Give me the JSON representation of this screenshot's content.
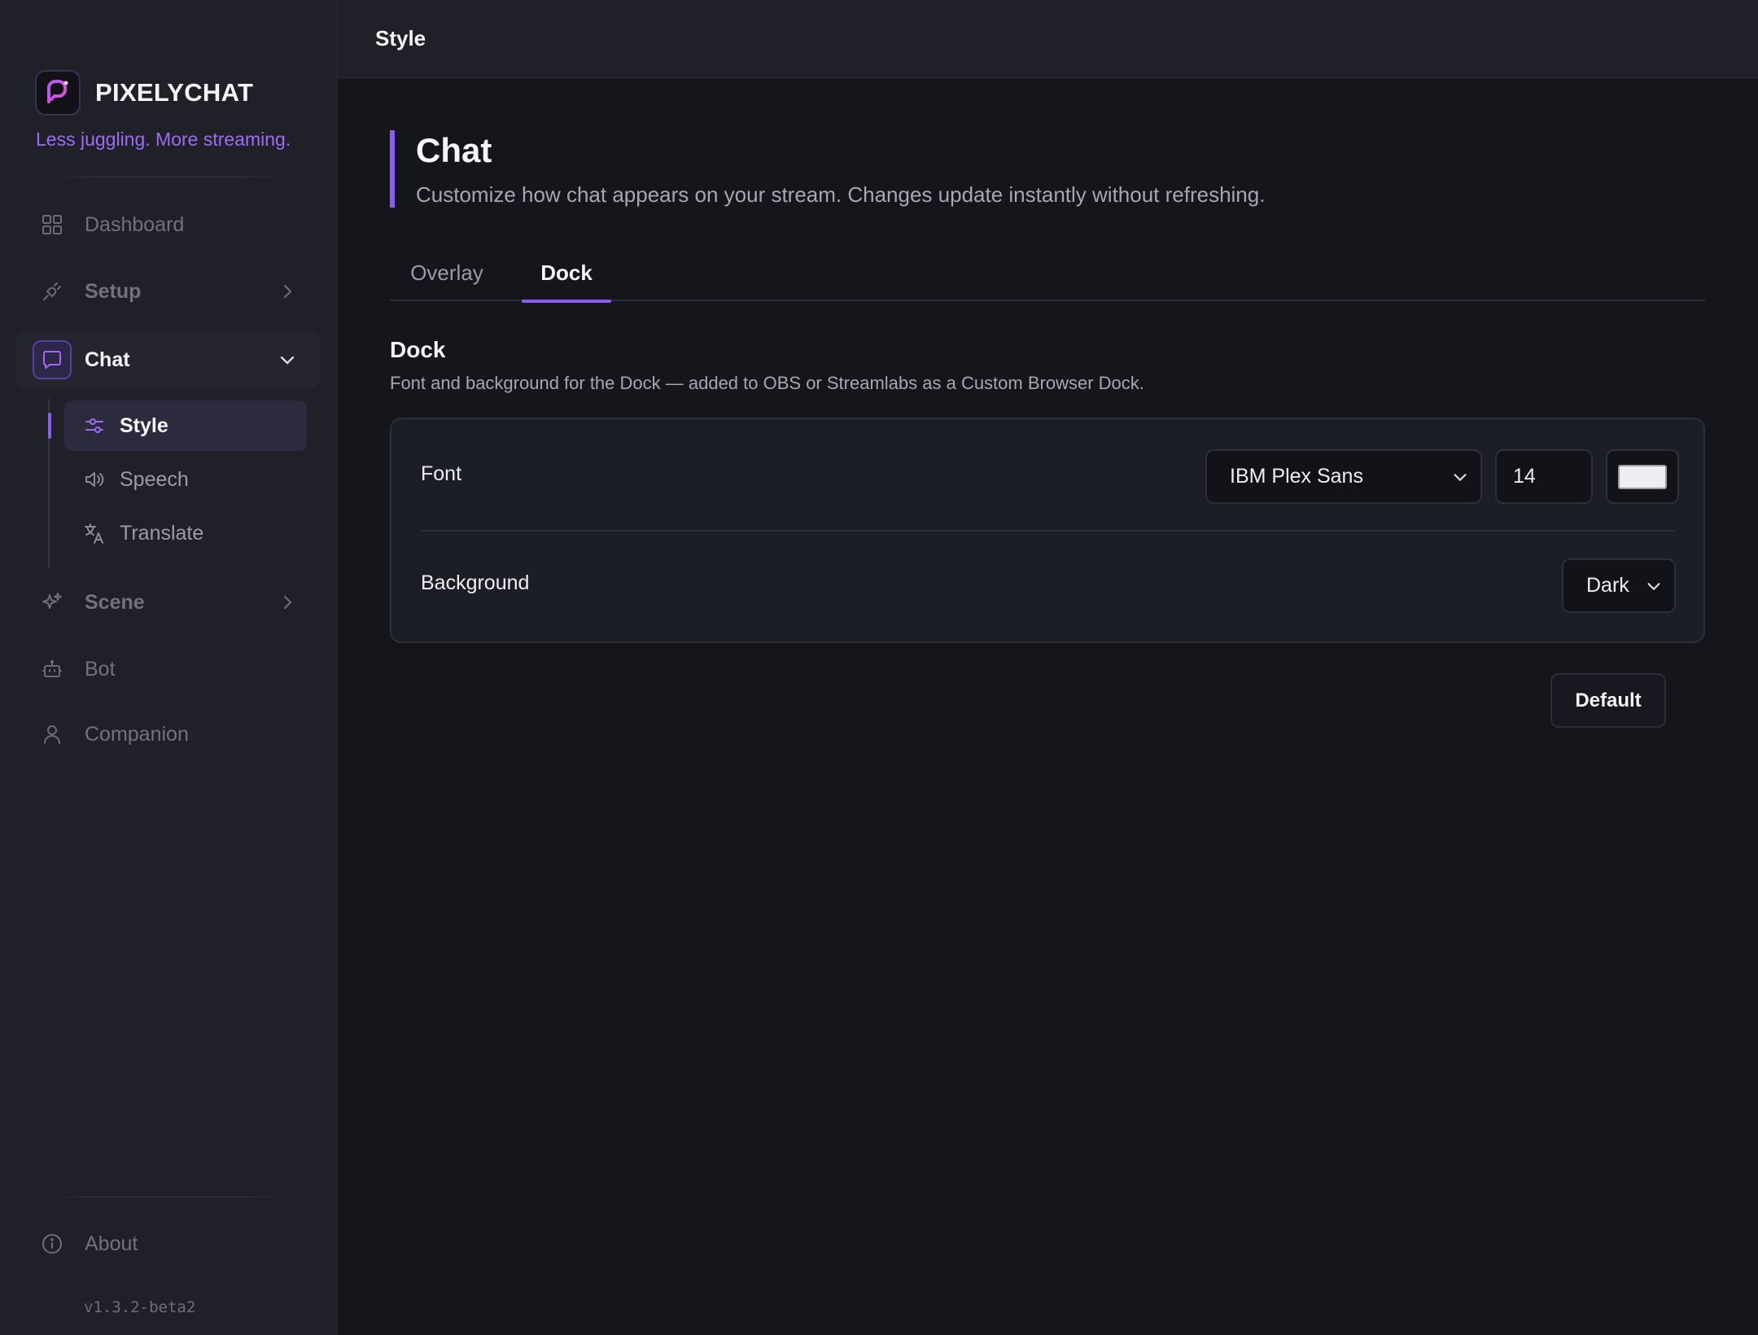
{
  "brand": {
    "name": "PIXELYCHAT",
    "tagline": "Less juggling. More streaming."
  },
  "nav": {
    "dashboard": "Dashboard",
    "setup": "Setup",
    "chat": "Chat",
    "chat_sub": {
      "style": "Style",
      "speech": "Speech",
      "translate": "Translate"
    },
    "scene": "Scene",
    "bot": "Bot",
    "companion": "Companion",
    "about": "About"
  },
  "version": "v1.3.2-beta2",
  "topbar": {
    "title": "Style"
  },
  "page": {
    "title": "Chat",
    "subtitle": "Customize how chat appears on your stream. Changes update instantly without refreshing."
  },
  "tabs": {
    "overlay": "Overlay",
    "dock": "Dock",
    "active": "Dock"
  },
  "section": {
    "title": "Dock",
    "description": "Font and background for the Dock — added to OBS or Streamlabs as a Custom Browser Dock."
  },
  "settings": {
    "font_label": "Font",
    "font_family_value": "IBM Plex Sans",
    "font_size_value": "14",
    "font_color": "#ededf2",
    "background_label": "Background",
    "background_value": "Dark"
  },
  "buttons": {
    "default": "Default"
  },
  "colors": {
    "accent": "#8b5cf6",
    "accent_text": "#9d6cf5"
  }
}
